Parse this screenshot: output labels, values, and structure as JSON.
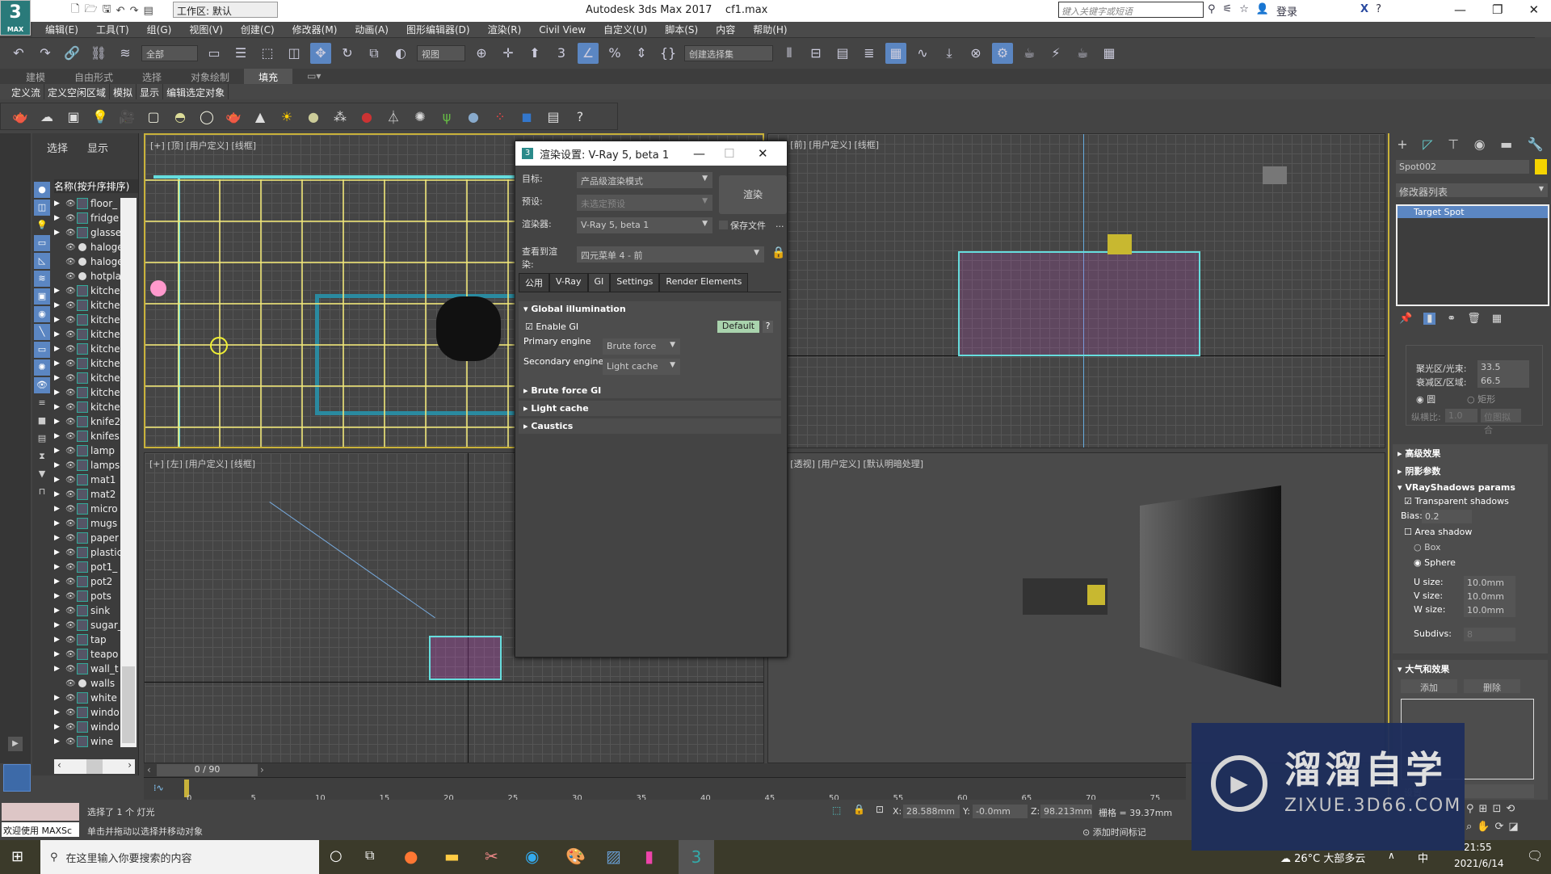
{
  "app": {
    "logo": "3",
    "logo_sub": "MAX",
    "workspace": "工作区: 默认",
    "title": "Autodesk 3ds Max 2017",
    "file": "cf1.max",
    "search_placeholder": "键入关键字或短语",
    "login": "登录"
  },
  "menu": [
    "编辑(E)",
    "工具(T)",
    "组(G)",
    "视图(V)",
    "创建(C)",
    "修改器(M)",
    "动画(A)",
    "图形编辑器(D)",
    "渲染(R)",
    "Civil View",
    "自定义(U)",
    "脚本(S)",
    "内容",
    "帮助(H)"
  ],
  "toolbar": {
    "filter": "全部",
    "coord": "视图",
    "selection_set": "创建选择集"
  },
  "ribbon": {
    "tabs": [
      "建模",
      "自由形式",
      "选择",
      "对象绘制",
      "填充"
    ],
    "active": 4,
    "row": [
      "定义流",
      "定义空闲区域",
      "模拟",
      "显示",
      "编辑选定对象"
    ]
  },
  "scene_explorer": {
    "tabs": [
      "选择",
      "显示"
    ],
    "header": "名称(按升序排序)",
    "items": [
      {
        "name": "floor_",
        "type": "geo"
      },
      {
        "name": "fridge",
        "type": "geo"
      },
      {
        "name": "glasse",
        "type": "geo"
      },
      {
        "name": "haloge",
        "type": "light"
      },
      {
        "name": "haloge",
        "type": "light"
      },
      {
        "name": "hotpla",
        "type": "light"
      },
      {
        "name": "kitche",
        "type": "geo"
      },
      {
        "name": "kitche",
        "type": "geo"
      },
      {
        "name": "kitche",
        "type": "geo"
      },
      {
        "name": "kitche",
        "type": "geo"
      },
      {
        "name": "kitche",
        "type": "geo"
      },
      {
        "name": "kitche",
        "type": "geo"
      },
      {
        "name": "kitche",
        "type": "geo"
      },
      {
        "name": "kitche",
        "type": "geo"
      },
      {
        "name": "kitche",
        "type": "geo"
      },
      {
        "name": "knife2",
        "type": "geo"
      },
      {
        "name": "knifes",
        "type": "geo"
      },
      {
        "name": "lamp",
        "type": "geo"
      },
      {
        "name": "lamps",
        "type": "geo"
      },
      {
        "name": "mat1",
        "type": "geo"
      },
      {
        "name": "mat2",
        "type": "geo"
      },
      {
        "name": "micro",
        "type": "geo"
      },
      {
        "name": "mugs",
        "type": "geo"
      },
      {
        "name": "paper",
        "type": "geo"
      },
      {
        "name": "plastic",
        "type": "geo"
      },
      {
        "name": "pot1_",
        "type": "geo"
      },
      {
        "name": "pot2",
        "type": "geo"
      },
      {
        "name": "pots",
        "type": "geo"
      },
      {
        "name": "sink",
        "type": "geo"
      },
      {
        "name": "sugar_",
        "type": "geo"
      },
      {
        "name": "tap",
        "type": "geo"
      },
      {
        "name": "teapo",
        "type": "geo"
      },
      {
        "name": "wall_t",
        "type": "geo"
      },
      {
        "name": "walls",
        "type": "light"
      },
      {
        "name": "white",
        "type": "geo"
      },
      {
        "name": "windo",
        "type": "geo"
      },
      {
        "name": "windo",
        "type": "geo"
      },
      {
        "name": "wine",
        "type": "geo"
      }
    ]
  },
  "viewports": {
    "top": "[+] [顶] [用户定义] [线框]",
    "front": "[+] [前] [用户定义] [线框]",
    "left": "[+] [左] [用户定义] [线框]",
    "persp": "[+] [透视] [用户定义] [默认明暗处理]"
  },
  "render_dialog": {
    "title": "渲染设置: V-Ray 5, beta 1",
    "target_label": "目标:",
    "target": "产品级渲染模式",
    "preset_label": "预设:",
    "preset": "未选定预设",
    "renderer_label": "渲染器:",
    "renderer": "V-Ray 5, beta 1",
    "save_file": "保存文件",
    "more": "...",
    "view_label": "查看到渲染:",
    "view": "四元菜单 4 - 前",
    "render_btn": "渲染",
    "tabs": [
      "公用",
      "V-Ray",
      "GI",
      "Settings",
      "Render Elements"
    ],
    "active_tab": 2,
    "gi": {
      "title": "Global illumination",
      "enable": "Enable GI",
      "enabled": true,
      "default_btn": "Default",
      "help": "?",
      "primary_label": "Primary engine",
      "primary": "Brute force",
      "secondary_label": "Secondary engine",
      "secondary": "Light cache"
    },
    "rollouts": [
      "Brute force GI",
      "Light cache",
      "Caustics"
    ]
  },
  "command_panel": {
    "object_name": "Spot002",
    "object_color": "#f5d400",
    "modifier_list": "修改器列表",
    "stack": [
      "Target Spot"
    ],
    "hotspot_label": "聚光区/光束:",
    "hotspot": "33.5",
    "falloff_label": "衰减区/区域:",
    "falloff": "66.5",
    "circle": "圆",
    "rect": "矩形",
    "aspect_label": "纵横比:",
    "aspect": "1.0",
    "bitmap_fit": "位图拟合",
    "sections": [
      "高级效果",
      "阴影参数",
      "VRayShadows params"
    ],
    "vrayshadows": {
      "transparent": "Transparent shadows",
      "transparent_on": true,
      "bias_label": "Bias:",
      "bias": "0.2",
      "area": "Area shadow",
      "area_on": false,
      "box": "Box",
      "sphere": "Sphere",
      "u_label": "U size:",
      "u": "10.0mm",
      "v_label": "V size:",
      "v": "10.0mm",
      "w_label": "W size:",
      "w": "10.0mm",
      "subdivs_label": "Subdivs:",
      "subdivs": "8"
    },
    "atmos": "大气和效果",
    "add": "添加",
    "delete": "删除",
    "setup": "设置"
  },
  "timeline": {
    "frame": "0 / 90",
    "ticks": [
      "0",
      "5",
      "10",
      "15",
      "20",
      "25",
      "30",
      "35",
      "40",
      "45",
      "50",
      "55",
      "60",
      "65",
      "70",
      "75"
    ]
  },
  "status": {
    "maxscript": "欢迎使用 MAXSc",
    "selected": "选择了 1 个 灯光",
    "hint": "单击并拖动以选择并移动对象",
    "x_label": "X:",
    "x": "28.588mm",
    "y_label": "Y:",
    "y": "-0.0mm",
    "z_label": "Z:",
    "z": "98.213mm",
    "grid": "栅格 = 39.37mm",
    "add_time_tag": "添加时间标记"
  },
  "taskbar": {
    "search": "在这里输入你要搜索的内容",
    "weather": "26°C 大部多云",
    "ime": "中",
    "time": "21:55",
    "date": "2021/6/14"
  },
  "watermark": {
    "title": "溜溜自学",
    "url": "ZIXUE.3D66.COM"
  }
}
